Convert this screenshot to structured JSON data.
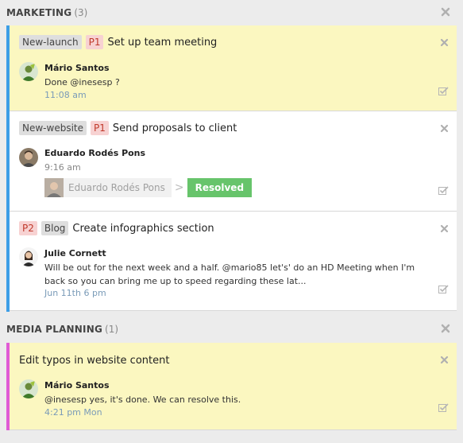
{
  "groups": [
    {
      "title": "MARKETING",
      "count": "(3)",
      "cards": [
        {
          "tags": [
            {
              "text": "New-launch",
              "style": "grey"
            },
            {
              "text": "P1",
              "style": "red"
            }
          ],
          "title": "Set up team meeting",
          "author": "Mário Santos",
          "comment": "Done @inesesp ?",
          "time": "11:08 am"
        },
        {
          "tags": [
            {
              "text": "New-website",
              "style": "grey"
            },
            {
              "text": "P1",
              "style": "red"
            }
          ],
          "title": "Send proposals to client",
          "author": "Eduardo Rodés Pons",
          "time": "9:16 am",
          "resolve_name": "Eduardo Rodés Pons",
          "resolve_chevron": ">",
          "resolved_label": "Resolved"
        },
        {
          "tags": [
            {
              "text": "P2",
              "style": "red"
            },
            {
              "text": "Blog",
              "style": "grey"
            }
          ],
          "title": "Create infographics section",
          "author": "Julie Cornett",
          "comment": "Will be out for the next week and a half. @mario85 let's' do an HD Meeting when I'm back so you can bring me up to speed regarding these lat...",
          "time": "Jun 11th 6 pm"
        }
      ]
    },
    {
      "title": "MEDIA PLANNING",
      "count": "(1)",
      "cards": [
        {
          "title": "Edit typos in website content",
          "author": "Mário Santos",
          "comment": "@inesesp yes, it's done. We can resolve this.",
          "time": "4:21 pm Mon"
        }
      ]
    }
  ],
  "colors": {
    "marketing_bar": "#3d9ee6",
    "media_bar": "#e05bd6",
    "highlight": "#fbf7c0",
    "resolved": "#67c46b"
  }
}
